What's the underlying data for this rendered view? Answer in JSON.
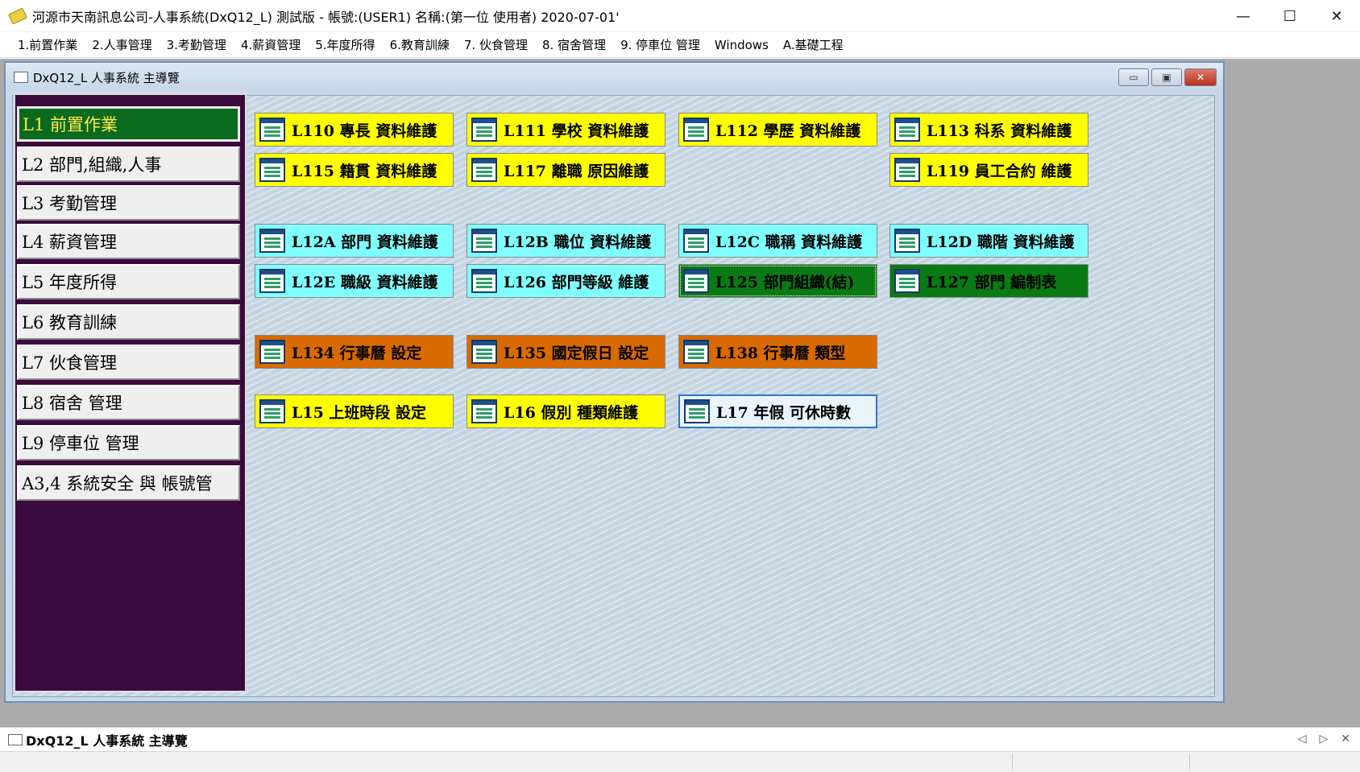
{
  "window": {
    "title": "河源市天南訊息公司-人事系統(DxQ12_L) 測試版 - 帳號:(USER1) 名稱:(第一位 使用者) 2020-07-01'",
    "minimize": "—",
    "maximize": "☐",
    "close": "✕"
  },
  "menu": [
    "1.前置作業",
    "2.人事管理",
    "3.考勤管理",
    "4.薪資管理",
    "5.年度所得",
    "6.教育訓練",
    "7. 伙食管理",
    "8. 宿舍管理",
    "9. 停車位 管理",
    "Windows",
    "A.基礎工程"
  ],
  "child_window": {
    "title": "DxQ12_L 人事系統 主導覽",
    "min": "▭",
    "restore": "▣",
    "close": "✕"
  },
  "sidebar": [
    "L1 前置作業",
    "L2 部門,組織,人事",
    "L3 考勤管理",
    "L4 薪資管理",
    "L5 年度所得",
    "L6 教育訓練",
    "L7 伙食管理",
    "L8 宿舍 管理",
    "L9 停車位 管理",
    "A3,4 系統安全 與 帳號管"
  ],
  "tiles": {
    "L110": "L110 專長 資料維護",
    "L111": "L111 學校 資料維護",
    "L112": "L112 學歷 資料維護",
    "L113": "L113 科系 資料維護",
    "L115": "L115 籍貫 資料維護",
    "L117": "L117 離職 原因維護",
    "L119": "L119 員工合約 維護",
    "L12A": "L12A 部門 資料維護",
    "L12B": "L12B 職位 資料維護",
    "L12C": "L12C 職稱 資料維護",
    "L12D": "L12D 職階 資料維護",
    "L12E": "L12E 職級 資料維護",
    "L126": "L126 部門等級 維護",
    "L125": "L125 部門組織(結)",
    "L127": "L127 部門 編制表",
    "L134": "L134 行事曆 設定",
    "L135": "L135 國定假日 設定",
    "L138": "L138 行事曆 類型",
    "L15": "L15 上班時段 設定",
    "L16": "L16 假別 種類維護",
    "L17": "L17 年假 可休時數"
  },
  "taskbar": {
    "label": "DxQ12_L 人事系統 主導覽",
    "prev": "◁",
    "next": "▷",
    "close": "✕"
  },
  "colors": {
    "sidebar_bg": "#3b0a3d",
    "active_item": "#0a6b1e",
    "active_text": "#ffe94d",
    "tile_yellow": "#ffff00",
    "tile_cyan": "#80ffff",
    "tile_green": "#0a7a14",
    "tile_orange": "#d96a00"
  }
}
